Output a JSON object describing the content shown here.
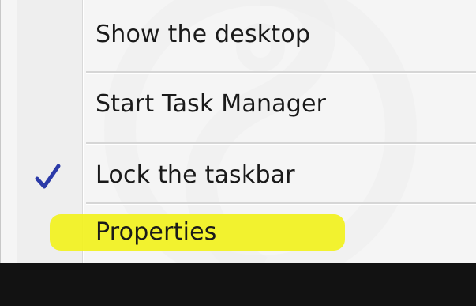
{
  "context_menu": {
    "items": [
      {
        "label": "Show the desktop"
      },
      {
        "label": "Start Task Manager"
      },
      {
        "label": "Lock the taskbar",
        "checked": true
      },
      {
        "label": "Properties",
        "highlighted": true
      }
    ]
  },
  "icons": {
    "check": "check-icon"
  },
  "colors": {
    "menu_background": "#f5f5f5",
    "highlight": "#f2f21a",
    "checkmark": "#2b3aa8",
    "taskbar": "#121212",
    "text": "#1a1a1a"
  }
}
